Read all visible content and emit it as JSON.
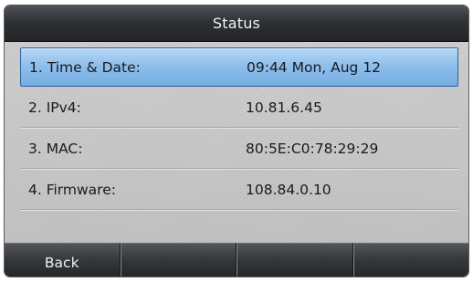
{
  "header": {
    "title": "Status"
  },
  "status": {
    "items": [
      {
        "label": "1. Time & Date:",
        "value": "09:44 Mon, Aug 12",
        "selected": true
      },
      {
        "label": "2. IPv4:",
        "value": "10.81.6.45",
        "selected": false
      },
      {
        "label": "3. MAC:",
        "value": "80:5E:C0:78:29:29",
        "selected": false
      },
      {
        "label": "4. Firmware:",
        "value": "108.84.0.10",
        "selected": false
      }
    ]
  },
  "softkeys": {
    "keys": [
      {
        "label": "Back"
      },
      {
        "label": ""
      },
      {
        "label": ""
      },
      {
        "label": ""
      }
    ]
  },
  "colors": {
    "title_bar": "#2f3235",
    "selection": "#8fbfec",
    "screen_background": "#c8c8c8"
  }
}
